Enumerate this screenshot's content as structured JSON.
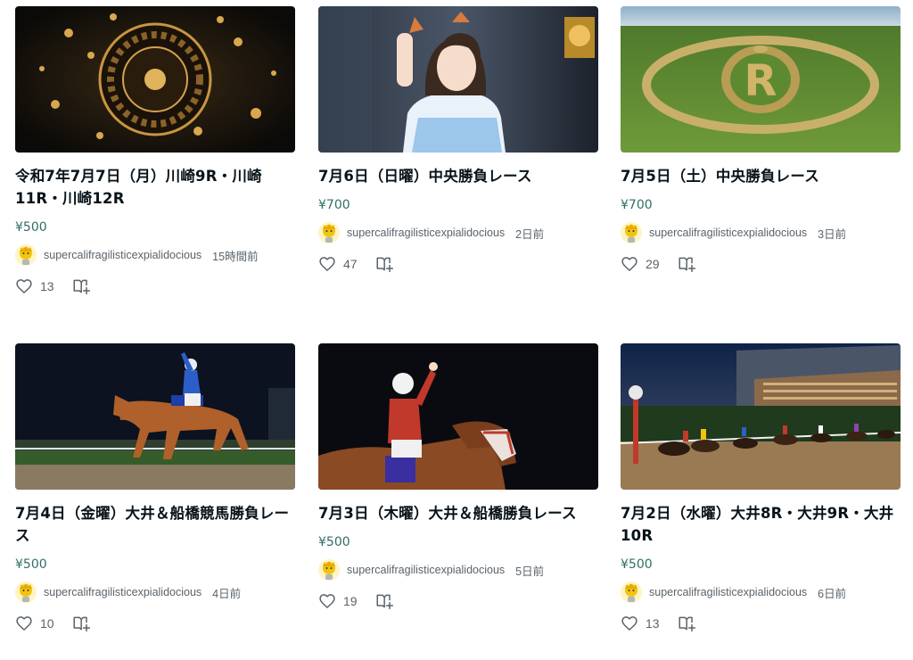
{
  "cards": [
    {
      "title": "令和7年7月7日（月）川崎9R・川崎11R・川崎12R",
      "price": "¥500",
      "author": "supercalifragilisticexpialidocious",
      "time": "15時間前",
      "likes": "13",
      "thumb_icon": "roulette-image"
    },
    {
      "title": "7月6日（日曜）中央勝負レース",
      "price": "¥700",
      "author": "supercalifragilisticexpialidocious",
      "time": "2日前",
      "likes": "47",
      "thumb_icon": "idol-photo-image"
    },
    {
      "title": "7月5日（土）中央勝負レース",
      "price": "¥700",
      "author": "supercalifragilisticexpialidocious",
      "time": "3日前",
      "likes": "29",
      "thumb_icon": "crop-field-r-logo-image"
    },
    {
      "title": "7月4日（金曜）大井＆船橋競馬勝負レース",
      "price": "¥500",
      "author": "supercalifragilisticexpialidocious",
      "time": "4日前",
      "likes": "10",
      "thumb_icon": "jockey-horse-image"
    },
    {
      "title": "7月3日（木曜）大井＆船橋勝負レース",
      "price": "¥500",
      "author": "supercalifragilisticexpialidocious",
      "time": "5日前",
      "likes": "19",
      "thumb_icon": "jockey-celebration-image"
    },
    {
      "title": "7月2日（水曜）大井8R・大井9R・大井10R",
      "price": "¥500",
      "author": "supercalifragilisticexpialidocious",
      "time": "6日前",
      "likes": "13",
      "thumb_icon": "horse-race-track-image"
    }
  ],
  "colors": {
    "price": "#2f6f63",
    "meta": "#5a636a",
    "title": "#08131a"
  }
}
